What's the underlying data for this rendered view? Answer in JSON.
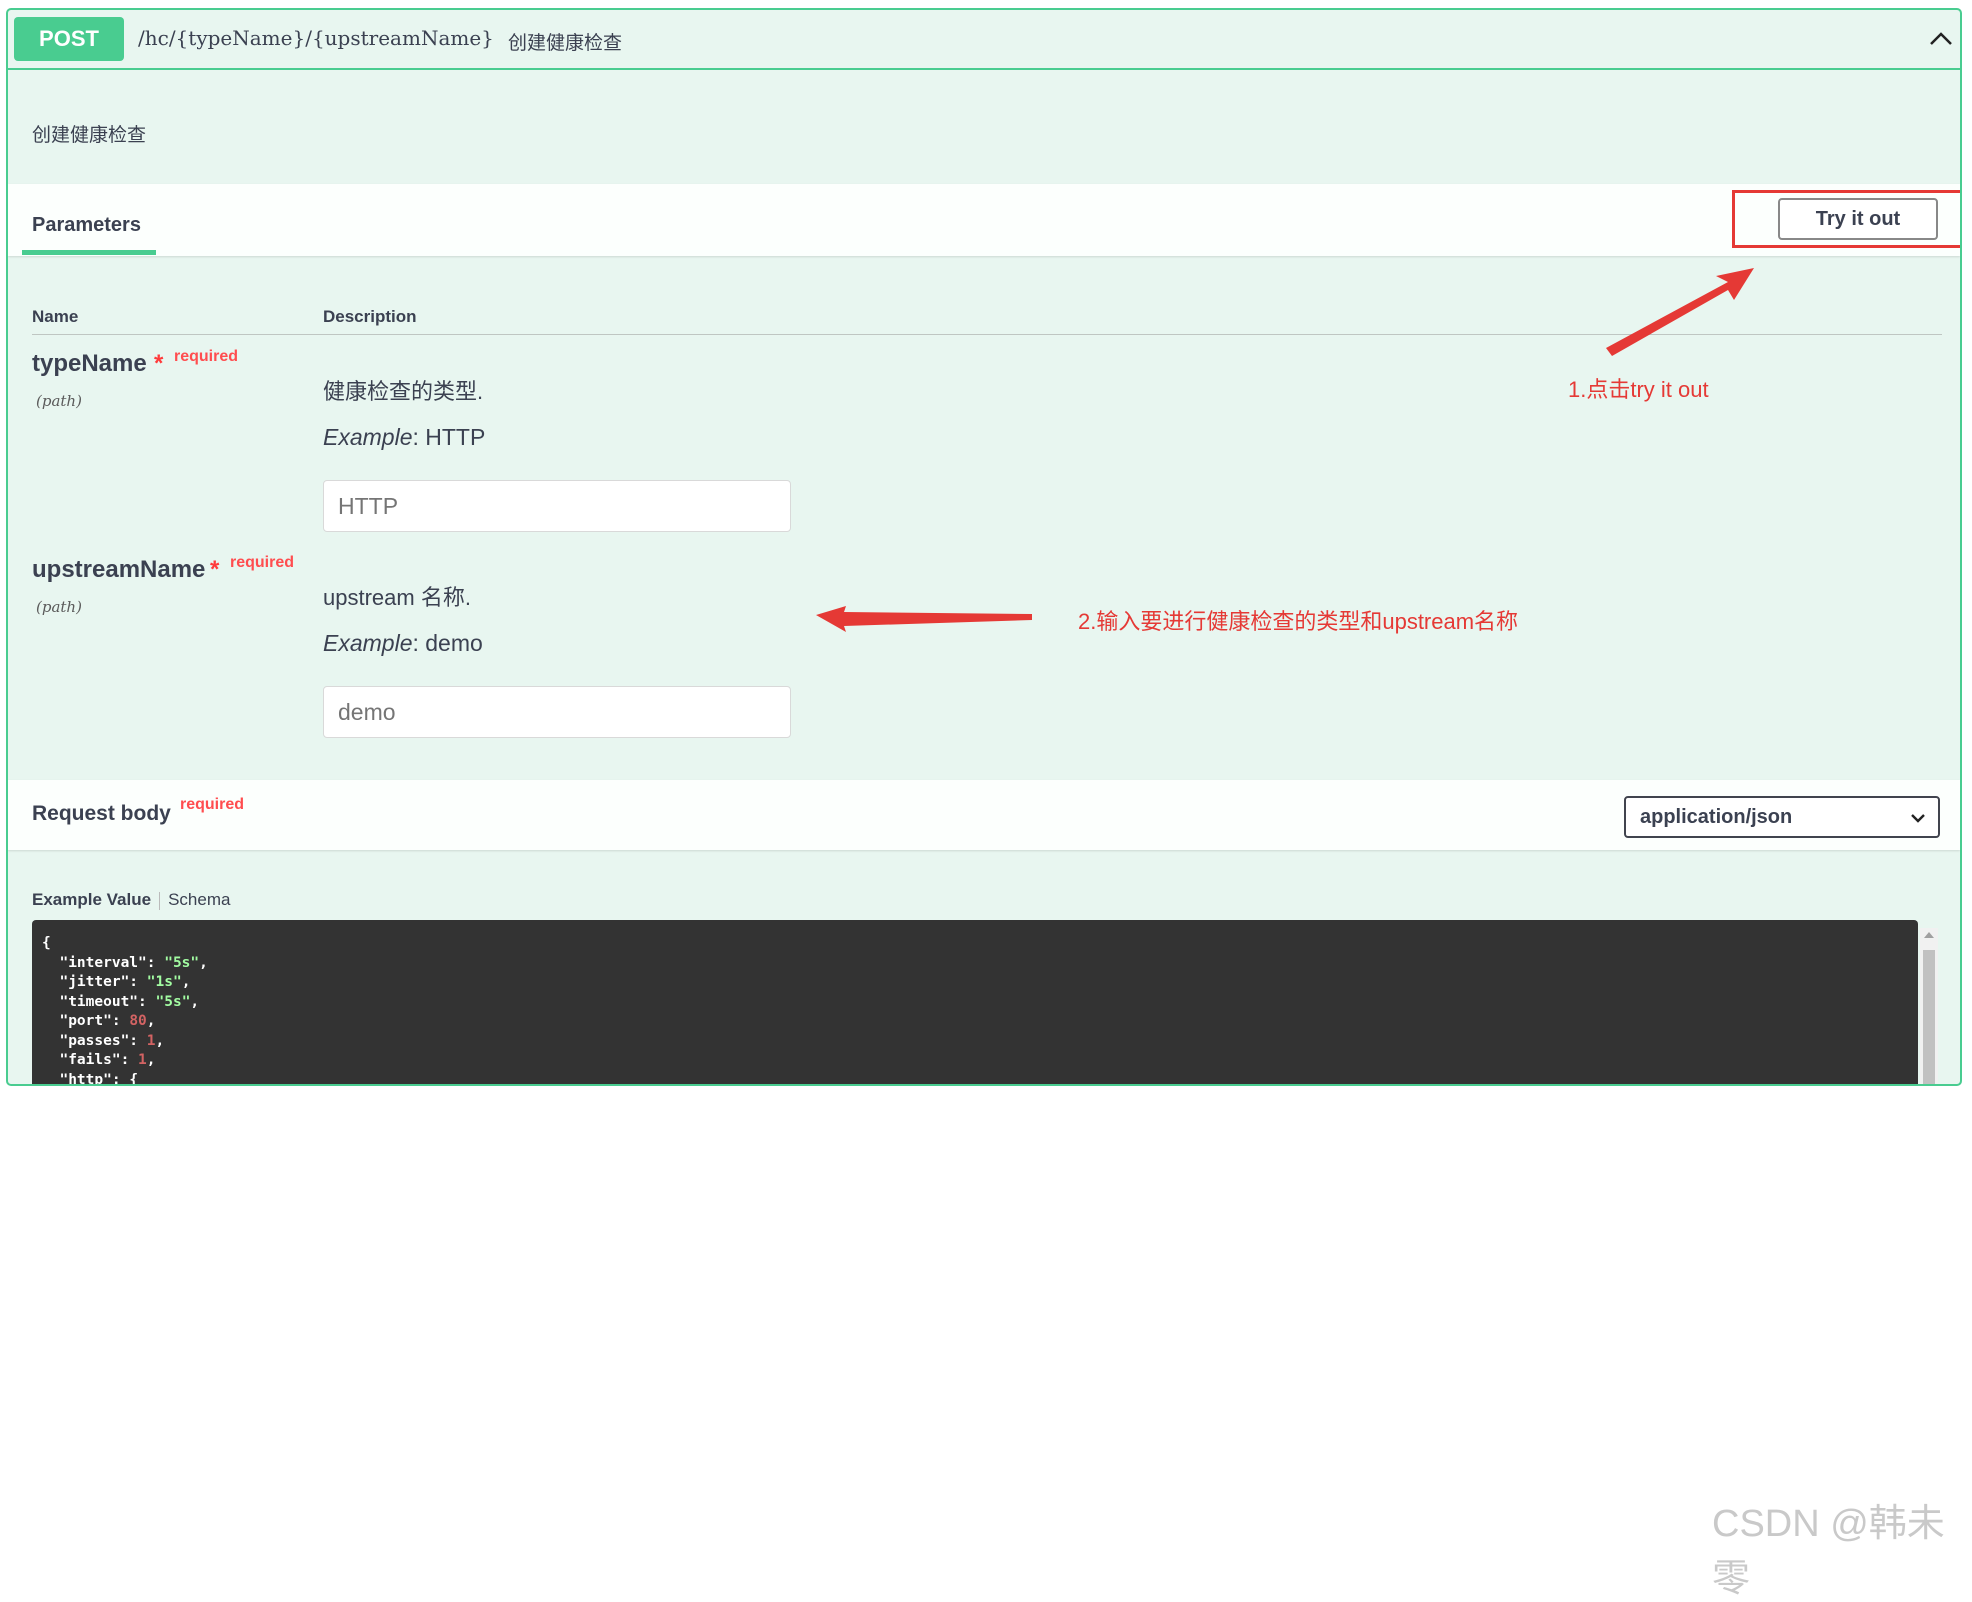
{
  "operation": {
    "method": "POST",
    "path": "/hc/{typeName}/{upstreamName}",
    "summary": "创建健康检查",
    "description": "创建健康检查"
  },
  "parameters": {
    "tab_label": "Parameters",
    "try_it_out": "Try it out",
    "col_name": "Name",
    "col_description": "Description",
    "items": [
      {
        "name": "typeName",
        "star": "*",
        "required": "required",
        "in": "(path)",
        "description": "健康检查的类型.",
        "example_label": "Example",
        "example_value": ": HTTP",
        "placeholder": "HTTP"
      },
      {
        "name": "upstreamName",
        "star": "*",
        "required": "required",
        "in": "(path)",
        "description": "upstream 名称.",
        "example_label": "Example",
        "example_value": ": demo",
        "placeholder": "demo"
      }
    ]
  },
  "annotations": {
    "step1": "1.点击try it out",
    "step2": "2.输入要进行健康检查的类型和upstream名称",
    "color": "#e53935"
  },
  "request_body": {
    "title": "Request body",
    "required": "required",
    "content_type": "application/json",
    "tab_example": "Example Value",
    "tab_schema": "Schema",
    "example_lines": [
      {
        "text": "{"
      },
      {
        "key": "  \"interval\": ",
        "val": "\"5s\"",
        "type": "s",
        "tail": ","
      },
      {
        "key": "  \"jitter\": ",
        "val": "\"1s\"",
        "type": "s",
        "tail": ","
      },
      {
        "key": "  \"timeout\": ",
        "val": "\"5s\"",
        "type": "s",
        "tail": ","
      },
      {
        "key": "  \"port\": ",
        "val": "80",
        "type": "n",
        "tail": ","
      },
      {
        "key": "  \"passes\": ",
        "val": "1",
        "type": "n",
        "tail": ","
      },
      {
        "key": "  \"fails\": ",
        "val": "1",
        "type": "n",
        "tail": ","
      },
      {
        "key": "  \"http\": ",
        "val": "",
        "type": "",
        "tail": "{"
      }
    ]
  },
  "watermark": "CSDN @韩未零",
  "colors": {
    "post": "#49cc90",
    "background": "#e8f6f0",
    "required": "#ff4d4f",
    "code_bg": "#333333"
  }
}
